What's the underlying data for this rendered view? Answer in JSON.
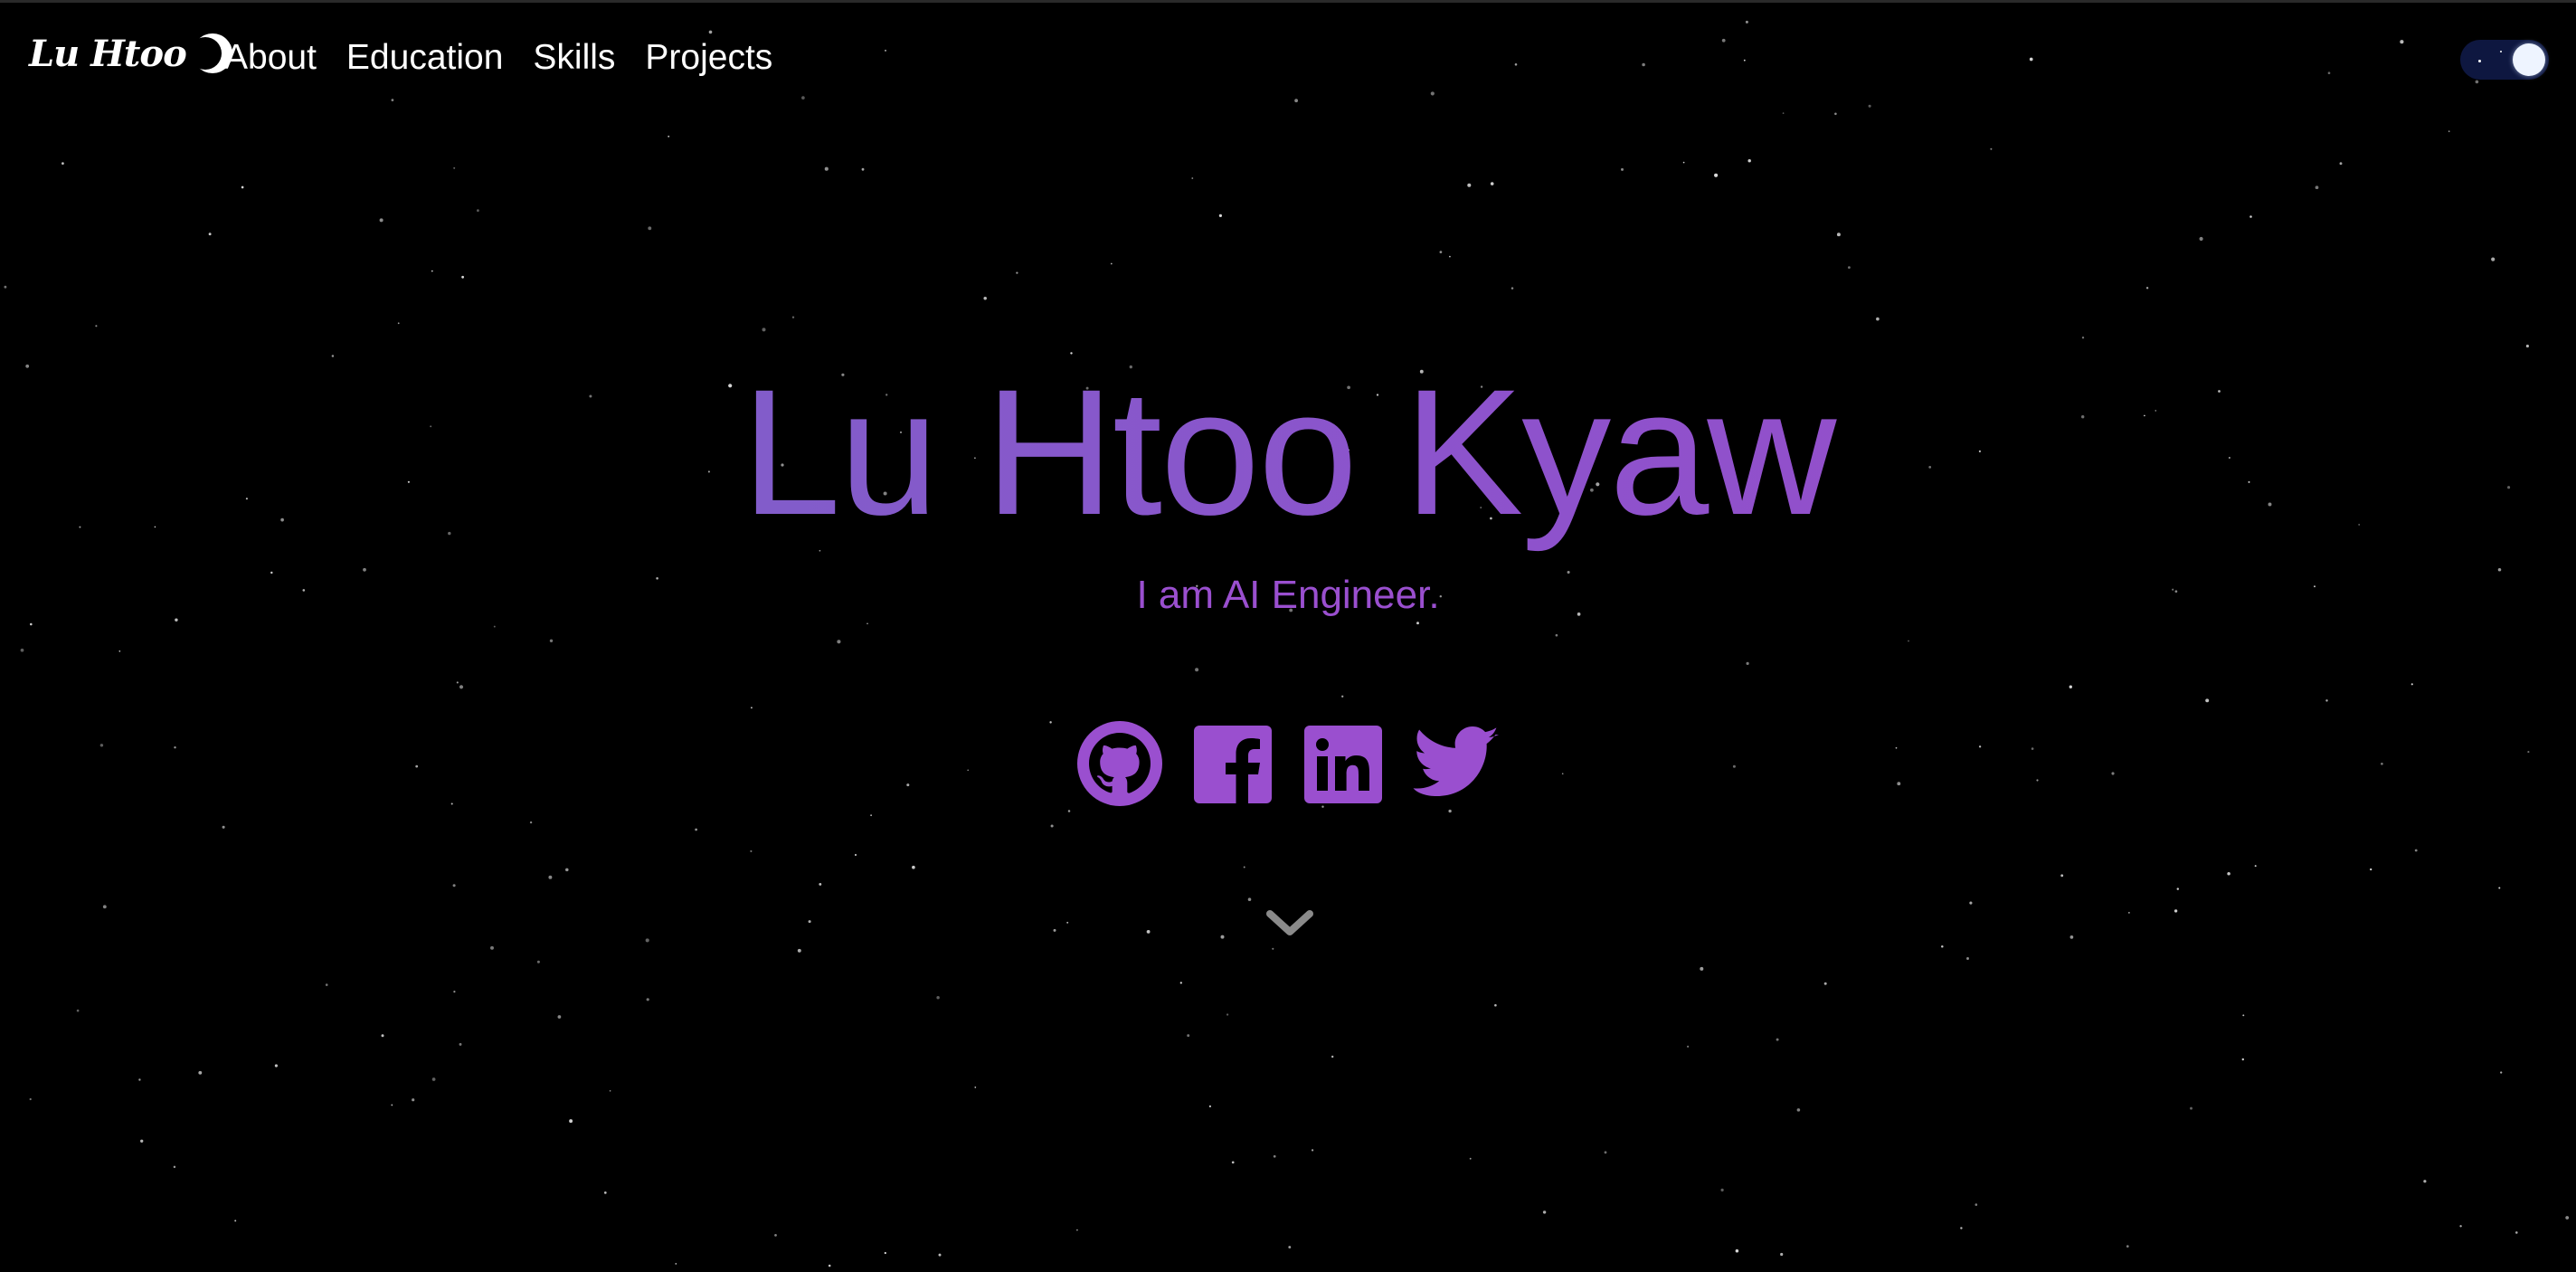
{
  "navbar": {
    "brand_text": "Lu Htoo",
    "links": [
      {
        "label": "About"
      },
      {
        "label": "Education"
      },
      {
        "label": "Skills"
      },
      {
        "label": "Projects"
      }
    ]
  },
  "hero": {
    "name": "Lu Htoo Kyaw",
    "subtitle": "I am AI Engineer."
  },
  "socials": [
    {
      "icon": "github-icon"
    },
    {
      "icon": "facebook-icon"
    },
    {
      "icon": "linkedin-icon"
    },
    {
      "icon": "twitter-icon"
    }
  ],
  "theme_toggle": {
    "mode": "dark"
  },
  "colors": {
    "background": "#000000",
    "accent_purple": "#9a4fcf",
    "gradient_start": "#7666c8",
    "gradient_end": "#9b4bc7",
    "toggle_track": "#0e1740",
    "chevron": "#8a8a8a"
  }
}
